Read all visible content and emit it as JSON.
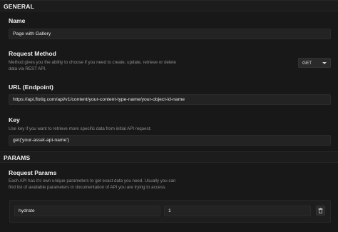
{
  "sections": {
    "general": "GENERAL",
    "params": "PARAMS"
  },
  "name": {
    "label": "Name",
    "value": "Page with Gallery"
  },
  "request_method": {
    "label": "Request Method",
    "description_line1": "Method gives you the ability to choose if you need to create, update, retrieve or delete",
    "description_line2": "data via REST API.",
    "selected": "GET"
  },
  "url": {
    "label": "URL (Endpoint)",
    "value": "https://api.flotiq.com/api/v1/content/your-content-type-name/your-object-id-name"
  },
  "key": {
    "label": "Key",
    "description": "Use key if you want to retrieve more specific data from initial API request.",
    "value": "get('your-asset-api-name')"
  },
  "request_params": {
    "label": "Request Params",
    "description_line1": "Each API has it's own unique parameters to get exact data you need. Usually you can",
    "description_line2": "find list of available parameters in documentation of API you are trying to access.",
    "params": [
      {
        "name": "hydrate",
        "value": "1"
      }
    ]
  },
  "icons": {
    "dropdown": "chevron-down-icon",
    "delete": "trash-icon"
  }
}
